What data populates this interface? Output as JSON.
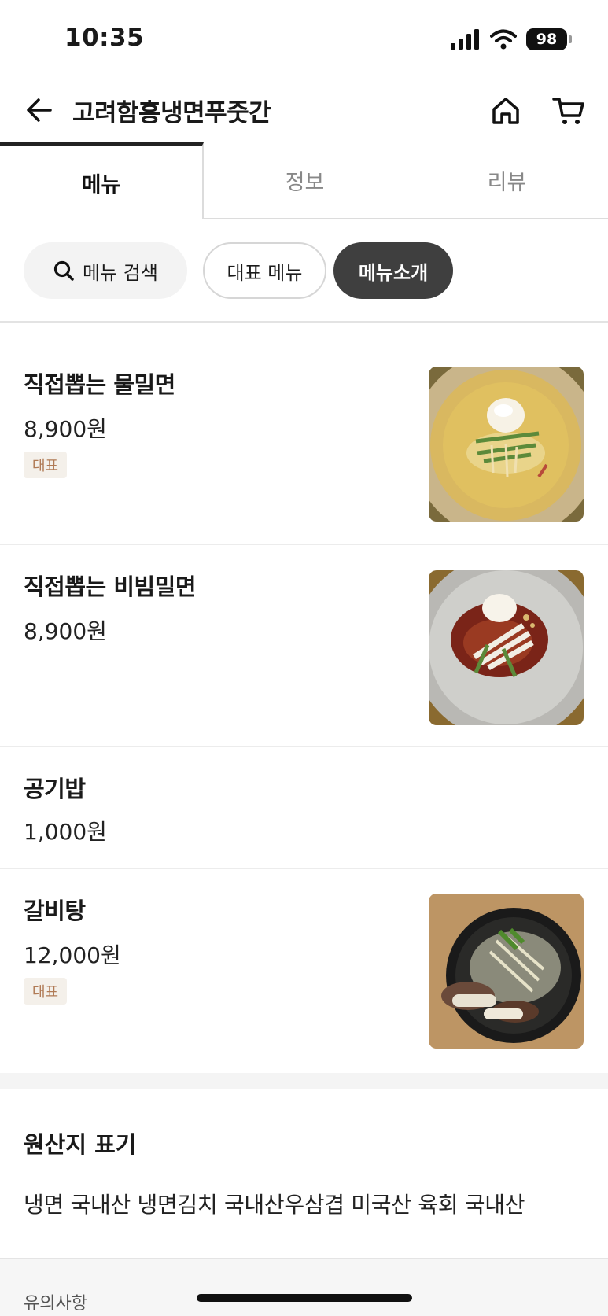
{
  "status_bar": {
    "time": "10:35",
    "battery": "98"
  },
  "header": {
    "title": "고려함흥냉면푸줏간"
  },
  "tabs": [
    {
      "label": "메뉴",
      "active": true
    },
    {
      "label": "정보",
      "active": false
    },
    {
      "label": "리뷰",
      "active": false
    }
  ],
  "chips": {
    "search": "메뉴 검색",
    "representative": "대표 메뉴",
    "intro": "메뉴소개"
  },
  "menu": [
    {
      "name": "직접뽑는 물밀면",
      "price": "8,900원",
      "badge": "대표",
      "image": "mul-milmyeon"
    },
    {
      "name": "직접뽑는 비빔밀면",
      "price": "8,900원",
      "badge": "",
      "image": "bibim-milmyeon"
    },
    {
      "name": "공기밥",
      "price": "1,000원",
      "badge": "",
      "image": ""
    },
    {
      "name": "갈비탕",
      "price": "12,000원",
      "badge": "대표",
      "image": "galbitang"
    }
  ],
  "origin": {
    "title": "원산지 표기",
    "text": "냉면 국내산 냉면김치 국내산우삼겹 미국산 육회 국내산"
  },
  "notice": {
    "label": "유의사항"
  },
  "colors": {
    "accent_dark": "#3f3f3f",
    "badge_bg": "#f4f0ea",
    "badge_text": "#b07a55"
  }
}
